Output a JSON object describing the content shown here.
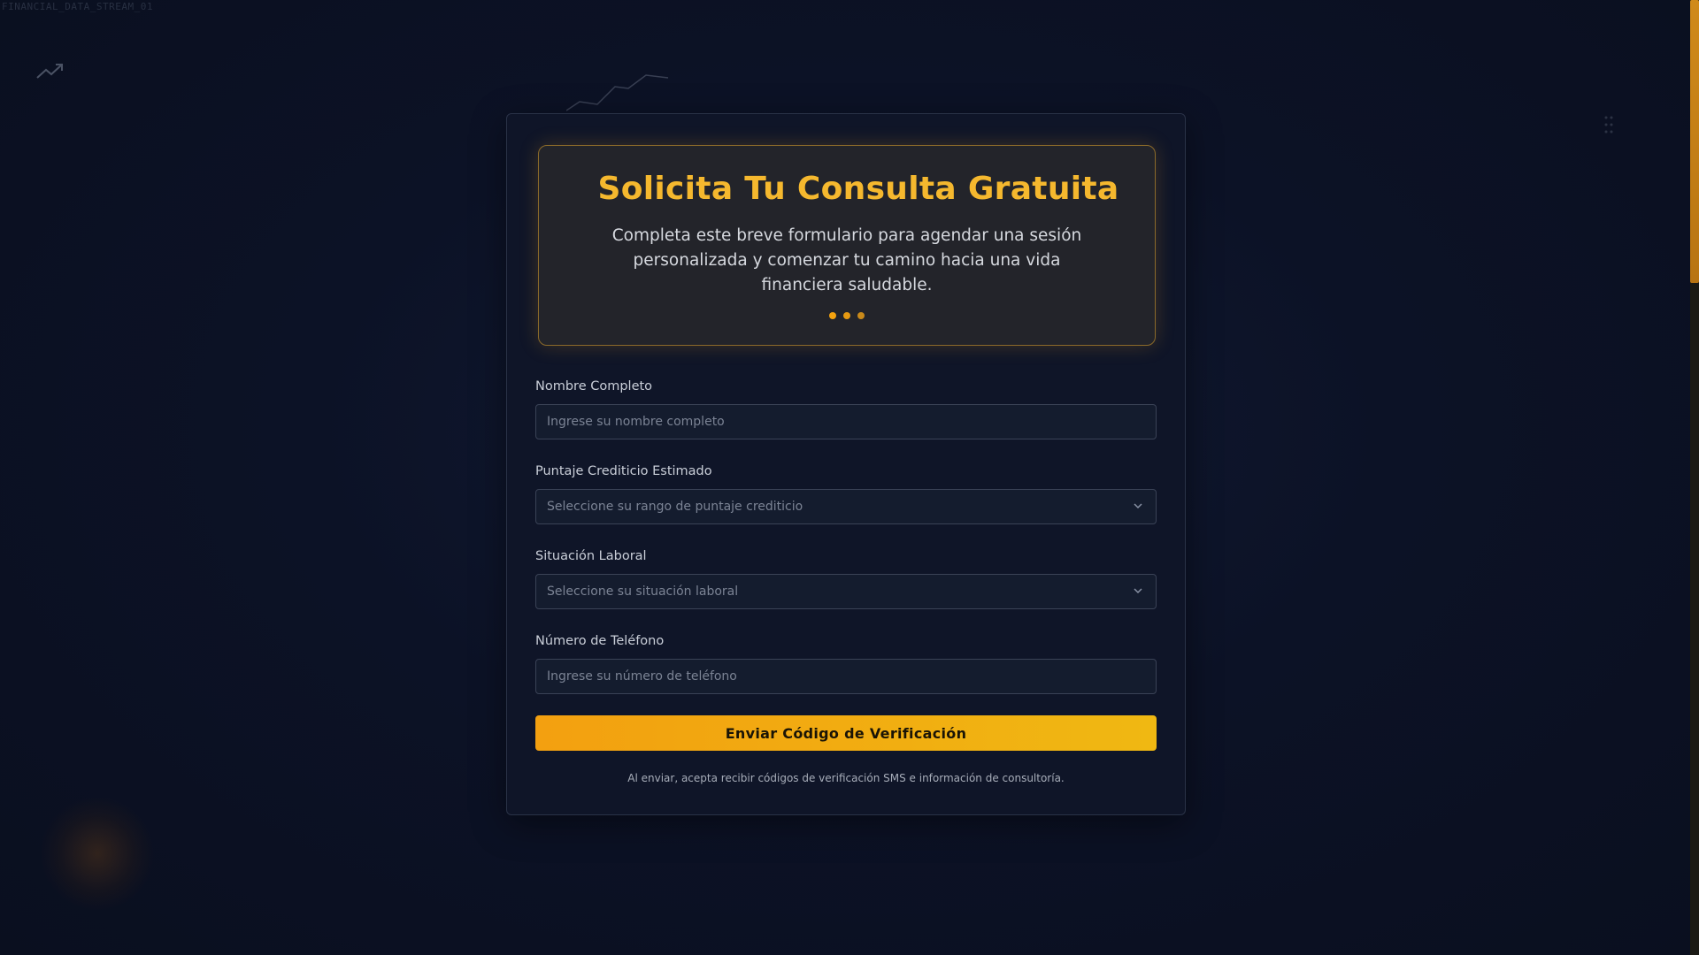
{
  "background": {
    "watermark_text": "FINANCIAL_DATA_STREAM_01"
  },
  "hero": {
    "title": "Solicita Tu Consulta Gratuita",
    "subtitle": "Completa este breve formulario para agendar una sesión personalizada y comenzar tu camino hacia una vida financiera saludable.",
    "dot_colors": [
      "#f5a30f",
      "#e69a12",
      "#c98a1a"
    ]
  },
  "form": {
    "name": {
      "label": "Nombre Completo",
      "placeholder": "Ingrese su nombre completo",
      "value": ""
    },
    "credit_score": {
      "label": "Puntaje Crediticio Estimado",
      "selected": "Seleccione su rango de puntaje crediticio"
    },
    "employment": {
      "label": "Situación Laboral",
      "selected": "Seleccione su situación laboral"
    },
    "phone": {
      "label": "Número de Teléfono",
      "placeholder": "Ingrese su número de teléfono",
      "value": ""
    },
    "submit_label": "Enviar Código de Verificación",
    "disclaimer": "Al enviar, acepta recibir códigos de verificación SMS e información de consultoría."
  },
  "colors": {
    "accent": "#f5b82e",
    "button_start": "#f3a010",
    "button_end": "#f0b812",
    "card_bg": "#0f1528",
    "hero_bg": "#23242a"
  },
  "icons": {
    "select_arrow": "chevron-down-icon",
    "background_trend": "trending-up-icon"
  }
}
